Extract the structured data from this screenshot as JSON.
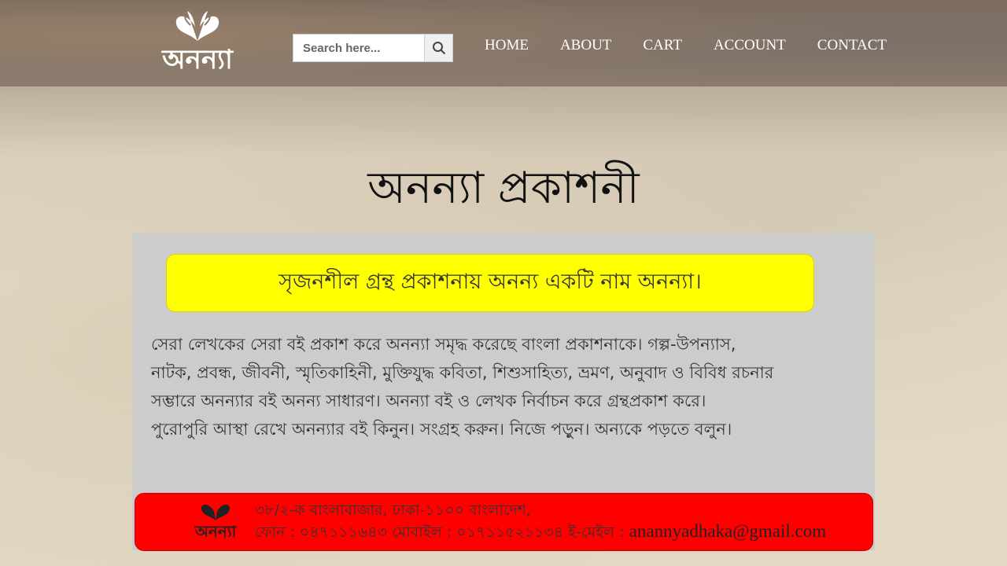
{
  "header": {
    "logo_text": "অনন্যা",
    "search": {
      "placeholder": "Search here...",
      "value": ""
    },
    "nav": [
      {
        "label": "HOME"
      },
      {
        "label": "ABOUT"
      },
      {
        "label": "CART"
      },
      {
        "label": "ACCOUNT"
      },
      {
        "label": "CONTACT"
      }
    ]
  },
  "main": {
    "title": "অনন্যা প্রকাশনী",
    "banner": {
      "tagline": "সৃজনশীল গ্রন্থ প্রকাশনায় অনন্য একটি নাম অনন্যা।",
      "lines": [
        "সেরা লেখকের সেরা বই প্রকাশ করে অনন্যা সমৃদ্ধ করেছে বাংলা প্রকাশনাকে। গল্প-উপন্যাস,",
        "নাটক, প্রবন্ধ, জীবনী, স্মৃতিকাহিনী, মুক্তিযুদ্ধ কবিতা, শিশুসাহিত্য, ভ্রমণ, অনুবাদ ও বিবিধ রচনার",
        "সম্ভারে অনন্যার বই অনন্য সাধারণ। অনন্যা বই ও লেখক নির্বাচন করে গ্রন্থপ্রকাশ করে।",
        "পুরোপুরি আস্থা রেখে অনন্যার বই কিনুন। সংগ্রহ করুন। নিজে পড়ুন। অন্যকে পড়তে বলুন।"
      ],
      "footer": {
        "logo_text": "অনন্যা",
        "address": "৩৮/২-ক বাংলাবাজার, ঢাকা-১১০০ বাংলাদেশ,",
        "phone_line": "ফোন : ০৪৭১১১৬৪৩ মোবাইল : ০১৭১১৫২১১৩৪ ই-মেইল : ",
        "email": "anannyadhaka@gmail.com"
      }
    }
  },
  "colors": {
    "tagline_bg": "#ffff00",
    "footer_bg": "#ff0000",
    "banner_bg": "#cccccc"
  }
}
